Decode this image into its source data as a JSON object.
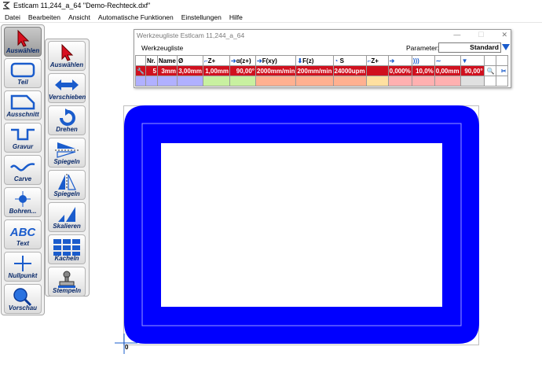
{
  "app": {
    "title": "Estlcam 11,244_a_64 \"Demo-Rechteck.dxf\""
  },
  "menu": [
    "Datei",
    "Bearbeiten",
    "Ansicht",
    "Automatische Funktionen",
    "Einstellungen",
    "Hilfe"
  ],
  "toolbar_left": [
    {
      "label": "Auswählen",
      "icon": "pointer-icon"
    },
    {
      "label": "Teil",
      "icon": "part-icon"
    },
    {
      "label": "Ausschnitt",
      "icon": "cutout-icon"
    },
    {
      "label": "Gravur",
      "icon": "engrave-icon"
    },
    {
      "label": "Carve",
      "icon": "carve-icon"
    },
    {
      "label": "Bohren...",
      "icon": "drill-icon"
    },
    {
      "label": "Text",
      "icon": "text-icon",
      "glyph": "ABC"
    },
    {
      "label": "Nullpunkt",
      "icon": "origin-icon"
    },
    {
      "label": "Vorschau",
      "icon": "preview-icon"
    }
  ],
  "toolbar_right": [
    {
      "label": "Auswählen",
      "icon": "pointer-icon"
    },
    {
      "label": "Verschieben",
      "icon": "move-icon"
    },
    {
      "label": "Drehen",
      "icon": "rotate-icon"
    },
    {
      "label": "Spiegeln",
      "icon": "mirror-horizontal-icon"
    },
    {
      "label": "Spiegeln",
      "icon": "mirror-vertical-icon"
    },
    {
      "label": "Skalieren",
      "icon": "scale-icon"
    },
    {
      "label": "Kacheln",
      "icon": "tile-icon"
    },
    {
      "label": "Stempeln",
      "icon": "stamp-icon"
    }
  ],
  "toollist": {
    "window_title": "Werkzeugliste Estlcam 11,244_a_64",
    "tab_label": "Werkzeugliste",
    "param_label": "Parameter:",
    "param_value": "Standard",
    "headers": [
      "Nr.",
      "Name",
      "Ø",
      "Z+",
      "α(z+)",
      "F(xy)",
      "F(z)",
      "S",
      "Z+"
    ],
    "row": {
      "nr": "5",
      "name": "3mm",
      "diameter": "3,00mm",
      "zstep": "1,00mm",
      "angle": "90,00°",
      "fxy": "2000mm/min",
      "fz": "200mm/min",
      "s": "24000upm",
      "p1": "0,000%",
      "p2": "10,0%",
      "p3": "0,00mm",
      "p4": "90,00°"
    },
    "empty_row_colors": [
      "#ffffff",
      "#b0b0ff",
      "#b0b0ff",
      "#b0b0ff",
      "#c8f0a0",
      "#c8f0a0",
      "#ffb090",
      "#ffb090",
      "#ffb090",
      "#ffe0a0",
      "#ffb0b0",
      "#ffb0b0",
      "#ffb0b0",
      "#e0e0e0"
    ]
  },
  "canvas": {
    "origin_label": "0",
    "shape_color": "#0000ff"
  }
}
